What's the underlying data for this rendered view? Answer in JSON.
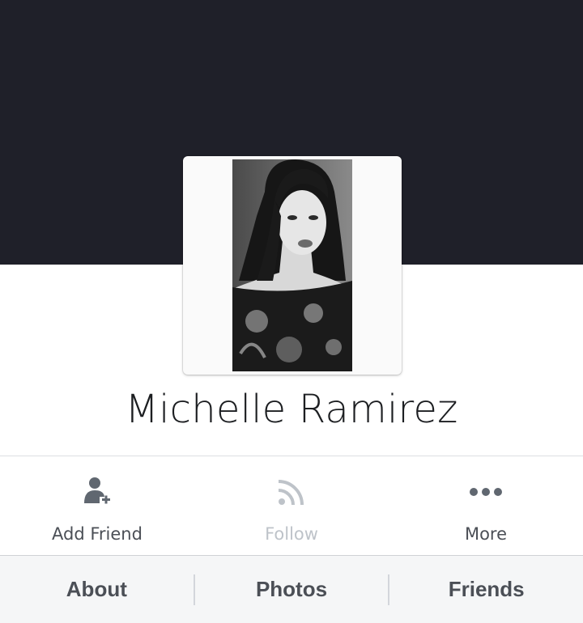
{
  "profile": {
    "name": "Michelle Ramirez"
  },
  "actions": {
    "add_friend": {
      "label": "Add Friend",
      "icon": "add-friend-icon"
    },
    "follow": {
      "label": "Follow",
      "icon": "rss-follow-icon",
      "disabled": true
    },
    "more": {
      "label": "More",
      "icon": "more-dots-icon"
    }
  },
  "tabs": [
    {
      "label": "About"
    },
    {
      "label": "Photos"
    },
    {
      "label": "Friends"
    }
  ],
  "colors": {
    "cover": "#1f2029",
    "icon": "#606770",
    "icon_disabled": "#bec3c9",
    "text": "#4b4f56"
  }
}
